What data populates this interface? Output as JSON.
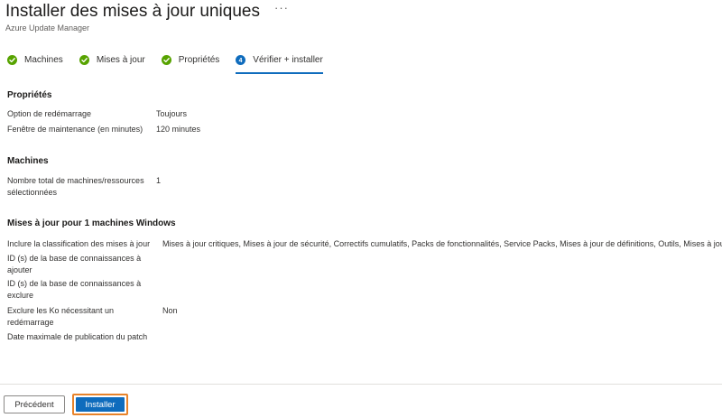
{
  "header": {
    "title": "Installer des mises à jour uniques",
    "more_label": "···",
    "subtitle": "Azure Update Manager"
  },
  "tabs": [
    {
      "label": "Machines",
      "state": "done",
      "icon": "check-circle-icon"
    },
    {
      "label": "Mises à jour",
      "state": "done",
      "icon": "check-circle-icon"
    },
    {
      "label": "Propriétés",
      "state": "done",
      "icon": "check-circle-icon"
    },
    {
      "label": "Vérifier + installer",
      "state": "active",
      "icon": "step-4-icon",
      "step": "4"
    }
  ],
  "colors": {
    "accent": "#0f6cbd",
    "success": "#57a300",
    "highlight": "#e8832a"
  },
  "sections": {
    "properties": {
      "title": "Propriétés",
      "rows": [
        {
          "label": "Option de redémarrage",
          "value": "Toujours"
        },
        {
          "label": "Fenêtre de maintenance (en minutes)",
          "value": "120 minutes"
        }
      ]
    },
    "machines": {
      "title": "Machines",
      "rows": [
        {
          "label": "Nombre total de machines/ressources sélectionnées",
          "value": "1"
        }
      ]
    },
    "updates": {
      "title": "Mises à jour pour 1 machines Windows",
      "rows": [
        {
          "label": "Inclure la classification des mises à jour",
          "value": "Mises à jour critiques, Mises à jour de sécurité, Correctifs cumulatifs, Packs de fonctionnalités, Service Packs, Mises à jour de définitions, Outils, Mises à jour"
        },
        {
          "label": "ID (s) de la base de connaissances à ajouter",
          "value": ""
        },
        {
          "label": "ID (s) de la base de connaissances à exclure",
          "value": ""
        },
        {
          "label": "Exclure les Ko nécessitant un redémarrage",
          "value": "Non"
        },
        {
          "label": "Date maximale de publication du patch",
          "value": ""
        }
      ]
    }
  },
  "footer": {
    "previous_label": "Précédent",
    "install_label": "Installer"
  }
}
